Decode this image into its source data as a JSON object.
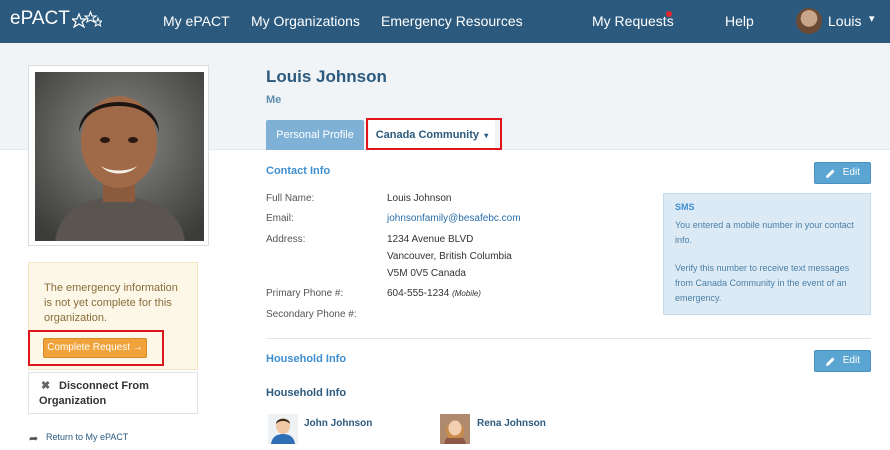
{
  "nav": {
    "brand": "ePACT",
    "links": [
      "My ePACT",
      "My Organizations",
      "Emergency Resources",
      "My Requests",
      "Help"
    ],
    "user_name": "Louis",
    "notification_color": "#e2262b"
  },
  "profile": {
    "name": "Louis Johnson",
    "relation": "Me"
  },
  "tabs": {
    "personal": "Personal Profile",
    "community": "Canada Community"
  },
  "sidebar": {
    "warning": "The emergency information is not yet complete for this organization.",
    "complete_button": "Complete Request →",
    "disconnect": "Disconnect From Organization",
    "return_link": "Return to My ePACT"
  },
  "contact": {
    "title": "Contact Info",
    "edit_label": "Edit",
    "labels": {
      "full_name": "Full Name:",
      "email": "Email:",
      "address": "Address:",
      "primary_phone": "Primary Phone #:",
      "secondary_phone": "Secondary Phone #:"
    },
    "values": {
      "full_name": "Louis Johnson",
      "email": "johnsonfamily@besafebc.com",
      "address_line1": "1234 Avenue BLVD",
      "address_line2": "Vancouver, British Columbia",
      "address_line3": "V5M 0V5 Canada",
      "primary_phone": "604-555-1234",
      "primary_phone_type": "(Mobile)"
    }
  },
  "sms": {
    "title": "SMS",
    "line1": "You entered a mobile number in your contact info.",
    "line2": "Verify this number to receive text messages from Canada Community in the event of an emergency."
  },
  "household": {
    "section_title": "Household Info",
    "edit_label": "Edit",
    "header": "Household Info",
    "members": [
      "John Johnson",
      "Rena Johnson"
    ]
  }
}
